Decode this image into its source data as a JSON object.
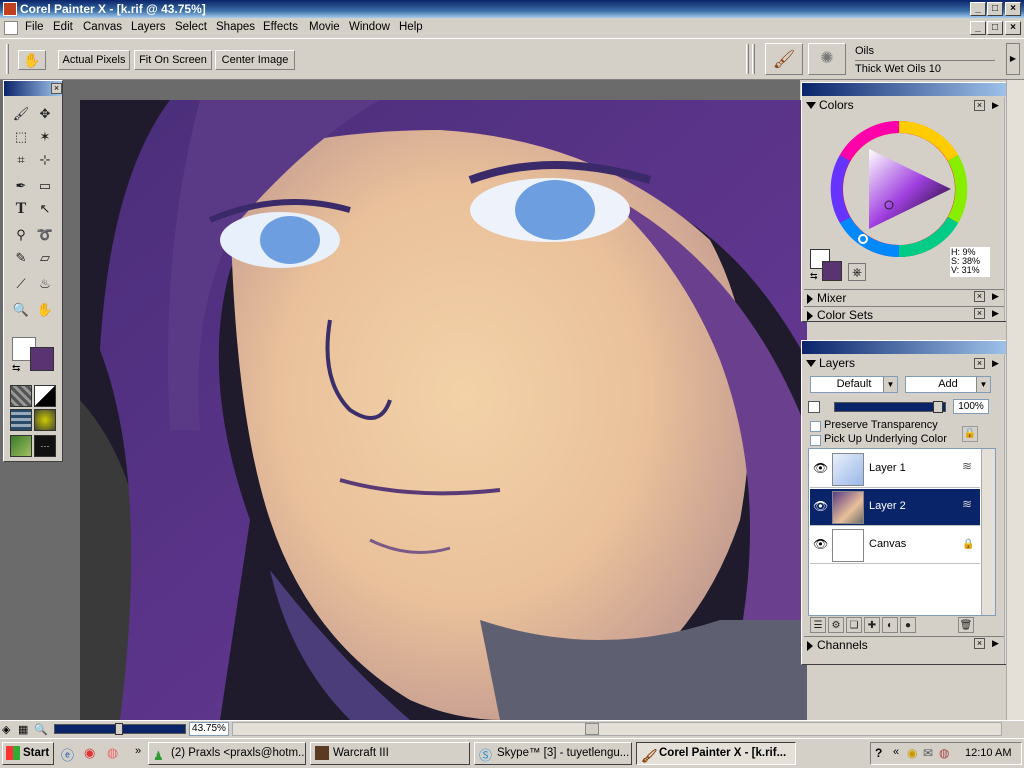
{
  "app": {
    "title": "Corel Painter X - [k.rif @ 43.75%]"
  },
  "menu": [
    "File",
    "Edit",
    "Canvas",
    "Layers",
    "Select",
    "Shapes",
    "Effects",
    "Movie",
    "Window",
    "Help"
  ],
  "toolbar": {
    "actual_pixels": "Actual Pixels",
    "fit_on_screen": "Fit On Screen",
    "center_image": "Center Image"
  },
  "brush": {
    "category": "Oils",
    "variant": "Thick Wet Oils 10"
  },
  "colors_panel": {
    "title": "Colors",
    "hsv": {
      "h": "H: 9%",
      "s": "S: 38%",
      "v": "V: 31%"
    },
    "primary_color": "#5a3372",
    "secondary_color": "#ffffff"
  },
  "mixer_panel": {
    "title": "Mixer"
  },
  "colorsets_panel": {
    "title": "Color Sets"
  },
  "layers_panel": {
    "title": "Layers",
    "composite_method": "Default",
    "composite_mode": "Add",
    "opacity": "100%",
    "preserve_transparency": "Preserve Transparency",
    "pick_up_underlying": "Pick Up Underlying Color",
    "layers": [
      {
        "name": "Layer 1",
        "selected": false
      },
      {
        "name": "Layer 2",
        "selected": true
      },
      {
        "name": "Canvas",
        "selected": false
      }
    ]
  },
  "channels_panel": {
    "title": "Channels"
  },
  "status": {
    "zoom": "43.75%"
  },
  "taskbar": {
    "start": "Start",
    "tasks": [
      {
        "label": "(2) Praxls <praxls@hotm...",
        "active": false
      },
      {
        "label": "Warcraft III",
        "active": false
      },
      {
        "label": "Skype™ [3] - tuyetlengu...",
        "active": false
      },
      {
        "label": "Corel Painter X - [k.rif...",
        "active": true
      }
    ],
    "clock": "12:10 AM"
  }
}
